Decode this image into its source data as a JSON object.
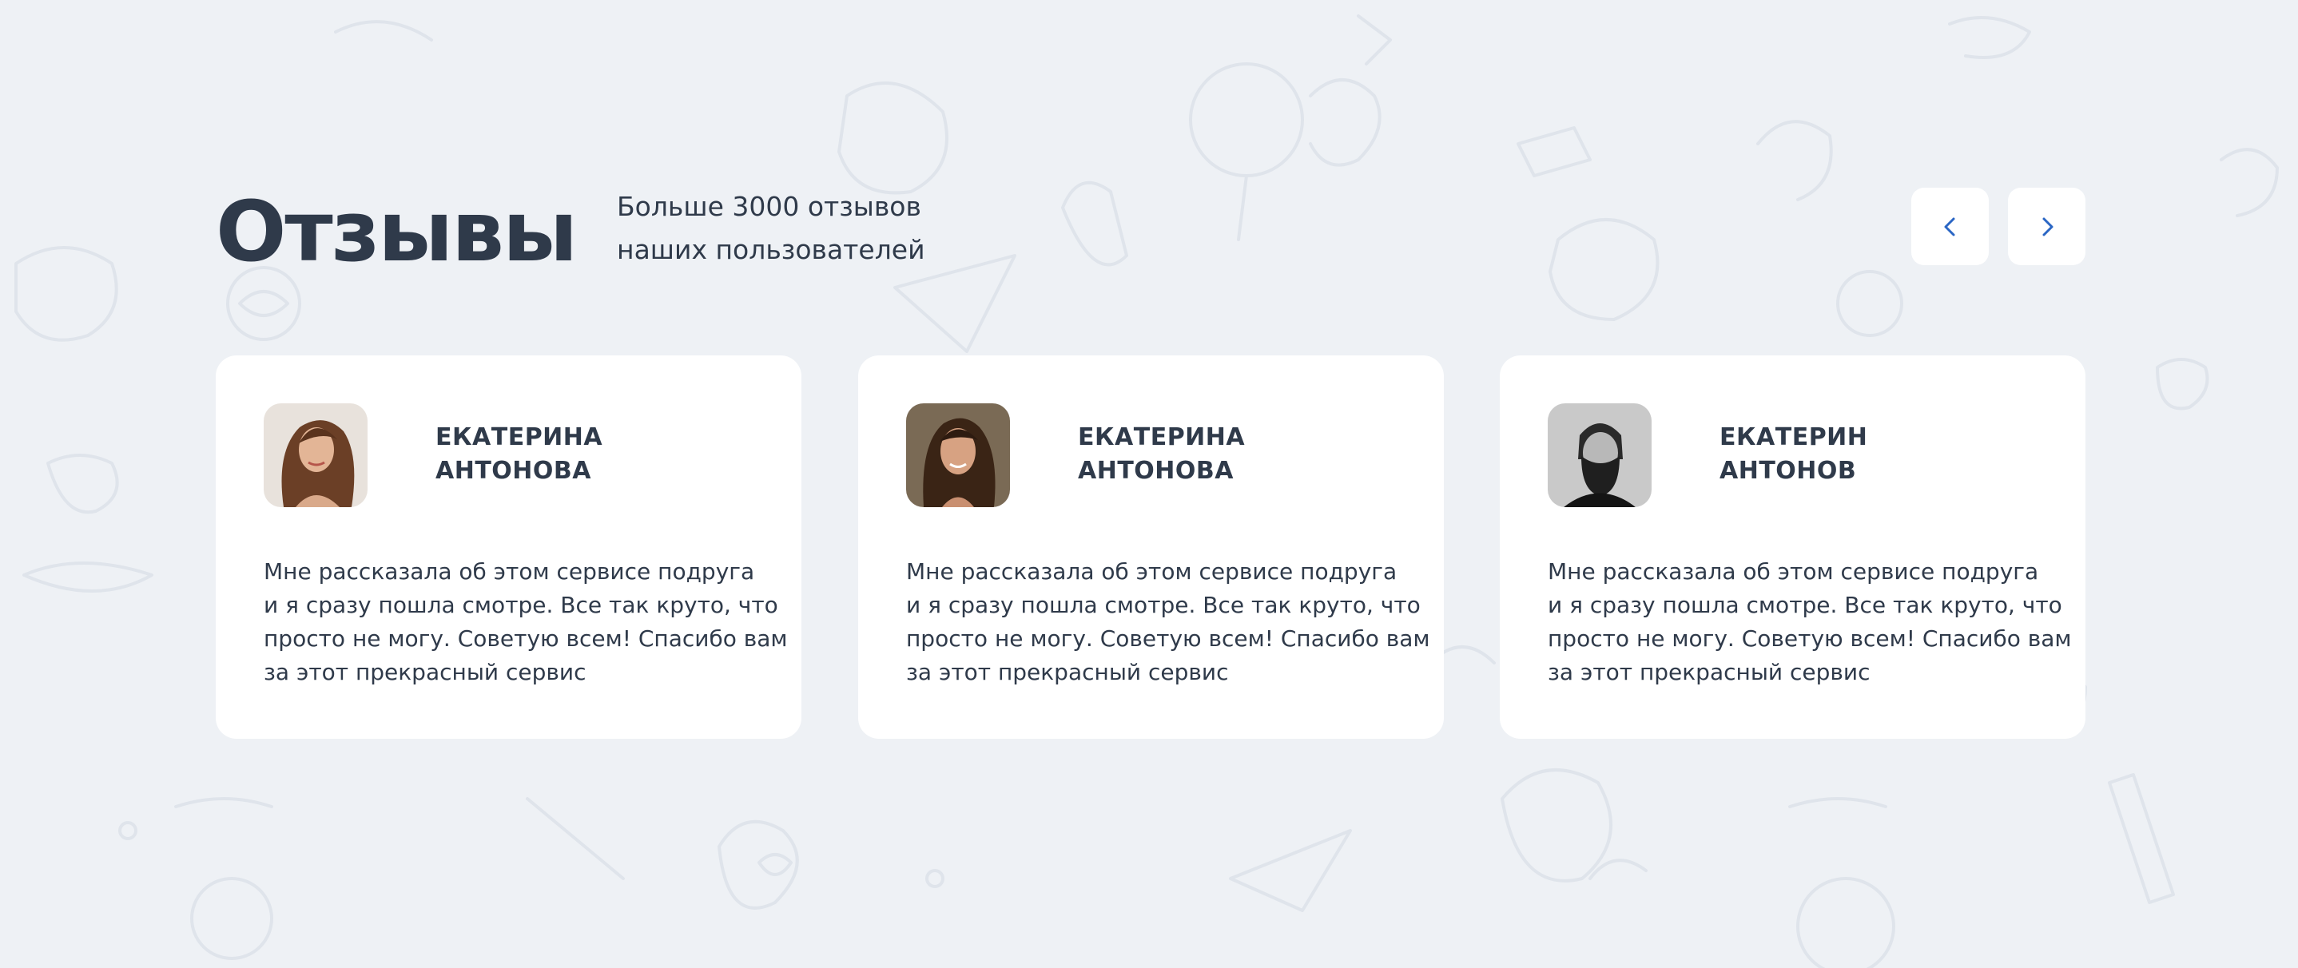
{
  "section": {
    "title": "Отзывы",
    "subtitle_line1": "Больше 3000 отзывов",
    "subtitle_line2": "наших пользователей"
  },
  "navigation": {
    "prev_icon": "chevron-left-icon",
    "next_icon": "chevron-right-icon",
    "icon_color": "#2a66c4"
  },
  "reviews": [
    {
      "name_line1": "Екатерина",
      "name_line2": "Антонова",
      "text_line1": "Мне рассказала об этом сервисе подруга",
      "text_line2": "и я сразу пошла смотре. Все так круто, что",
      "text_line3": "просто не могу. Советую всем! Спасибо вам",
      "text_line4": "за этот прекрасный сервис",
      "avatar": "woman-curly-hair-photo"
    },
    {
      "name_line1": "Екатерина",
      "name_line2": "Антонова",
      "text_line1": "Мне рассказала об этом сервисе подруга",
      "text_line2": "и я сразу пошла смотре. Все так круто, что",
      "text_line3": "просто не могу. Советую всем! Спасибо вам",
      "text_line4": "за этот прекрасный сервис",
      "avatar": "woman-dark-hair-photo"
    },
    {
      "name_line1": "Екатерин",
      "name_line2": "Антонов",
      "text_line1": "Мне рассказала об этом сервисе подруга",
      "text_line2": "и я сразу пошла смотре. Все так круто, что",
      "text_line3": "просто не могу. Советую всем! Спасибо вам",
      "text_line4": "за этот прекрасный сервис",
      "avatar": "bearded-man-photo"
    }
  ],
  "colors": {
    "background": "#eef1f5",
    "card": "#ffffff",
    "text": "#2f3a4a",
    "accent": "#2a66c4"
  }
}
